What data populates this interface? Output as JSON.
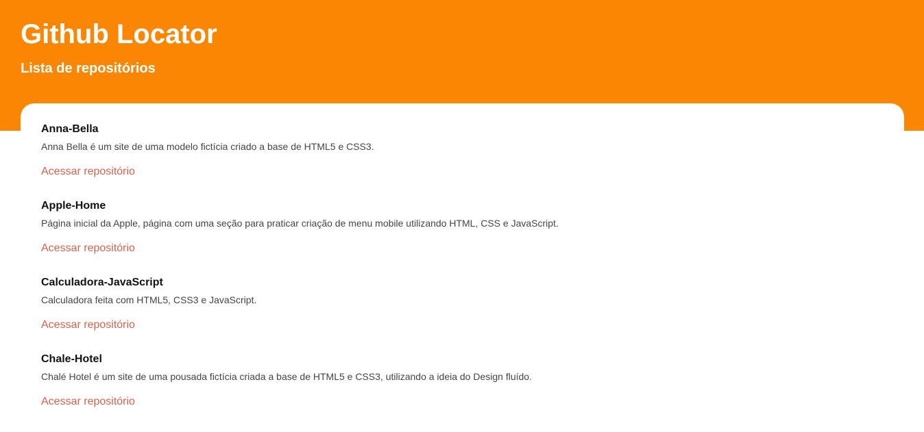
{
  "header": {
    "title": "Github Locator",
    "subtitle": "Lista de repositórios"
  },
  "repos": [
    {
      "name": "Anna-Bella",
      "description": "Anna Bella é um site de uma modelo fictícia criado a base de HTML5 e CSS3.",
      "link_label": "Acessar repositório"
    },
    {
      "name": "Apple-Home",
      "description": "Página inicial da Apple, página com uma seção para praticar criação de menu mobile utilizando HTML, CSS e JavaScript.",
      "link_label": "Acessar repositório"
    },
    {
      "name": "Calculadora-JavaScript",
      "description": "Calculadora feita com HTML5, CSS3 e JavaScript.",
      "link_label": "Acessar repositório"
    },
    {
      "name": "Chale-Hotel",
      "description": "Chalé Hotel é um site de uma pousada fictícia criada a base de HTML5 e CSS3, utilizando a ideia do Design fluído.",
      "link_label": "Acessar repositório"
    }
  ],
  "colors": {
    "header_bg": "#fb8604",
    "link": "#d9614a"
  }
}
